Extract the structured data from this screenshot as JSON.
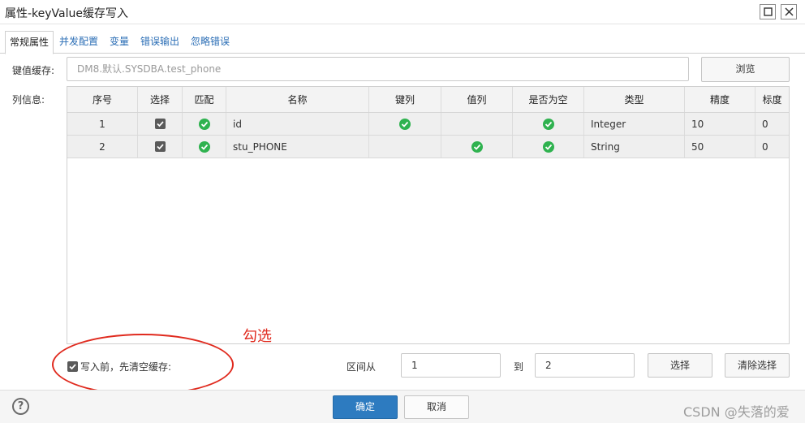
{
  "window": {
    "title": "属性-keyValue缓存写入"
  },
  "tabs": [
    {
      "label": "常规属性",
      "active": true
    },
    {
      "label": "并发配置",
      "active": false
    },
    {
      "label": "变量",
      "active": false
    },
    {
      "label": "错误输出",
      "active": false
    },
    {
      "label": "忽略错误",
      "active": false
    }
  ],
  "kv_cache": {
    "label": "键值缓存:",
    "value": "DM8.默认.SYSDBA.test_phone",
    "browse_label": "浏览"
  },
  "columns_info": {
    "label": "列信息:",
    "headers": [
      "序号",
      "选择",
      "匹配",
      "名称",
      "键列",
      "值列",
      "是否为空",
      "类型",
      "精度",
      "标度"
    ],
    "rows": [
      {
        "index": "1",
        "selected": true,
        "matched": true,
        "name": "id",
        "key_col": true,
        "value_col": false,
        "nullable": true,
        "type": "Integer",
        "precision": "10",
        "scale": "0"
      },
      {
        "index": "2",
        "selected": true,
        "matched": true,
        "name": "stu_PHONE",
        "key_col": false,
        "value_col": true,
        "nullable": true,
        "type": "String",
        "precision": "50",
        "scale": "0"
      }
    ]
  },
  "options": {
    "clear_before_write_label": "写入前，先清空缓存:",
    "clear_before_write_checked": true,
    "range_from_label": "区间从",
    "range_from_value": "1",
    "range_to_label": "到",
    "range_to_value": "2",
    "select_label": "选择",
    "clear_select_label": "清除选择"
  },
  "annotation": {
    "text": "勾选",
    "color": "#e02a1e"
  },
  "footer": {
    "help_glyph": "?",
    "ok_label": "确定",
    "cancel_label": "取消",
    "watermark": "CSDN @失落的爱"
  },
  "colors": {
    "accent": "#2d7bc0",
    "link": "#2a6db5",
    "success": "#2fb24f"
  }
}
